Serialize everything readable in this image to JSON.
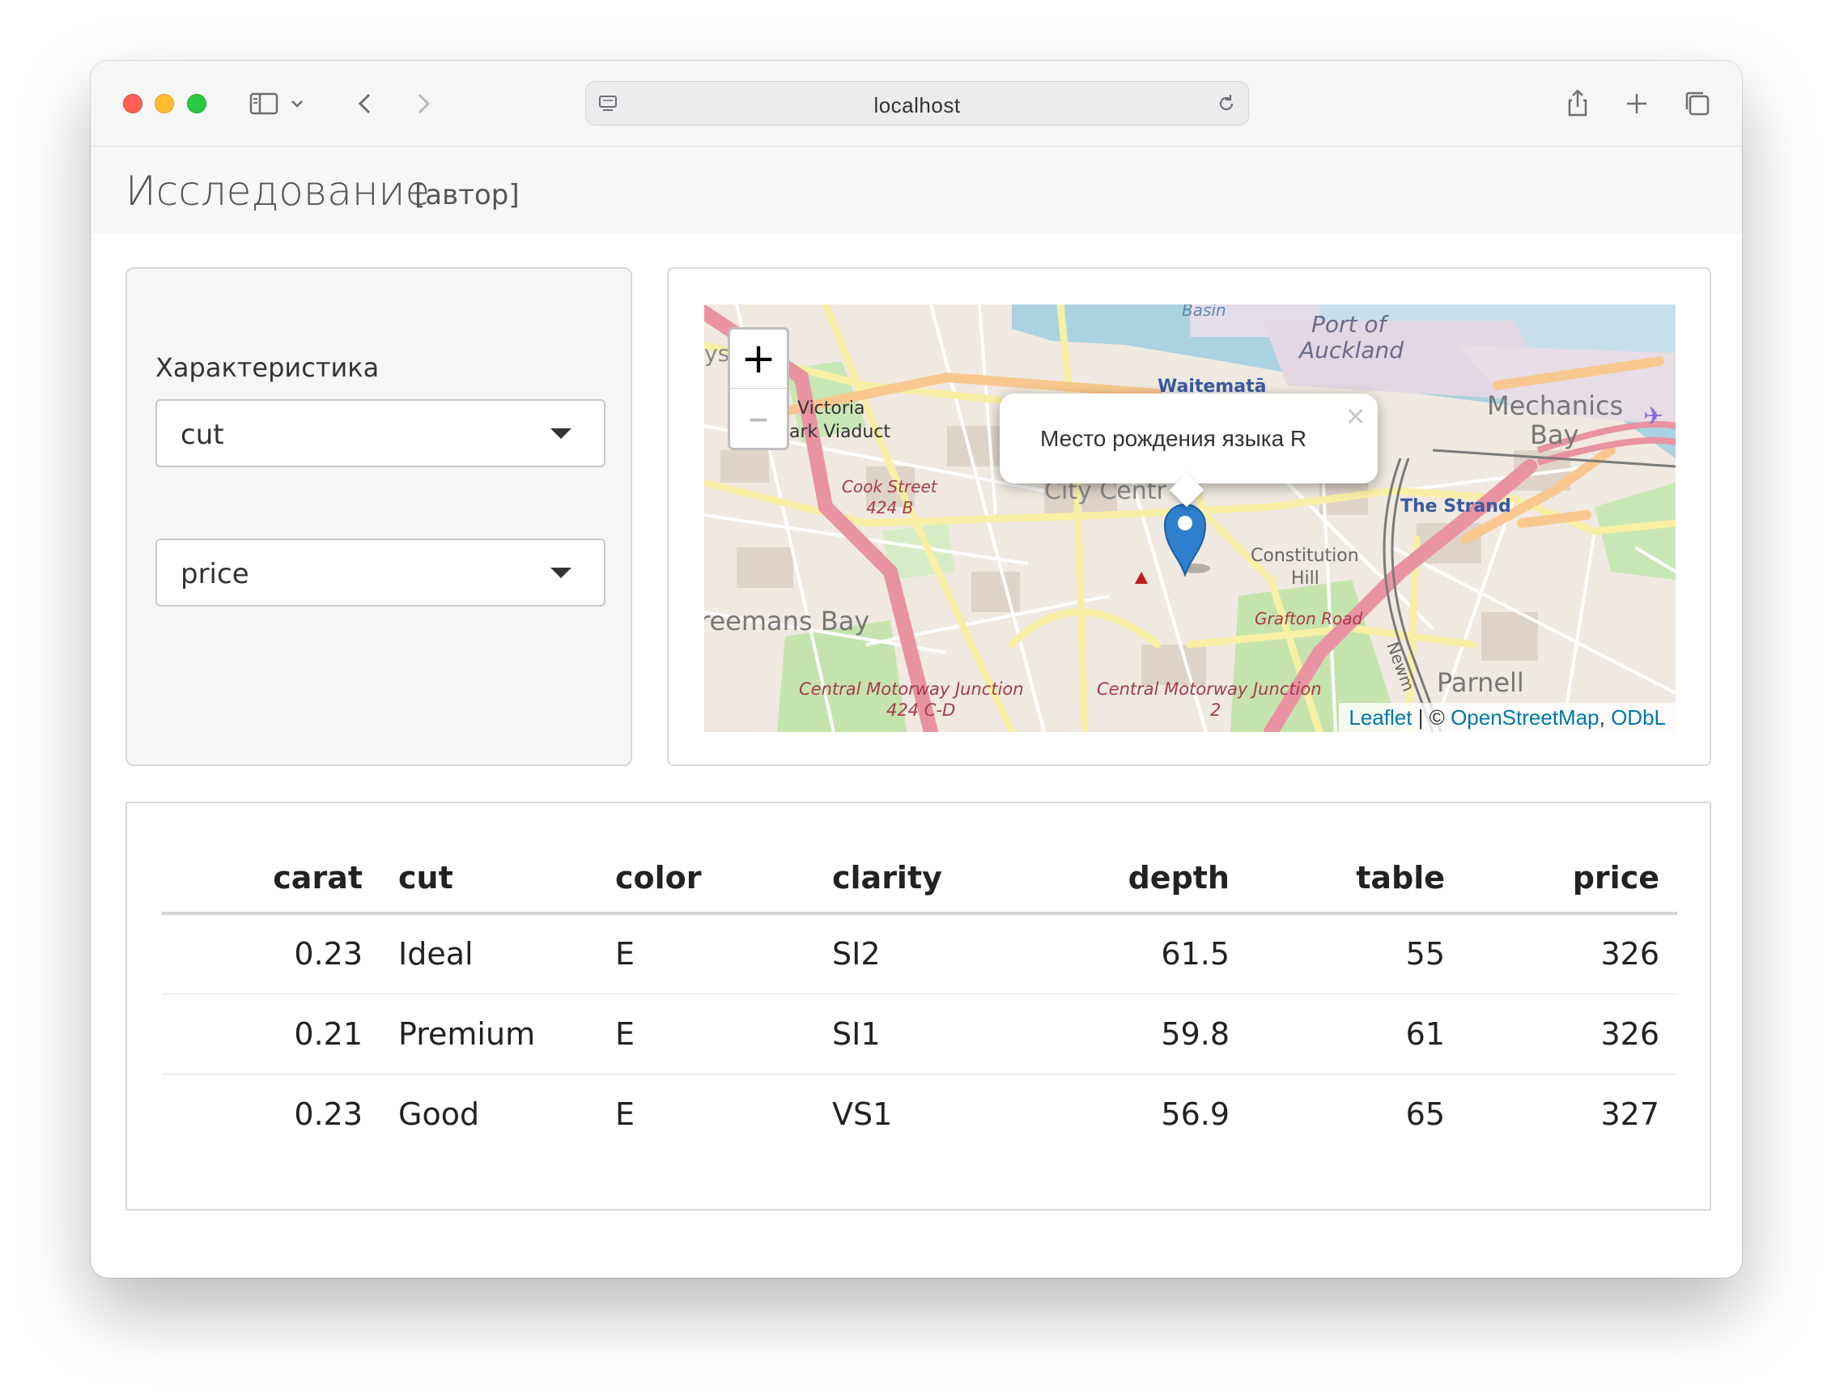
{
  "browser": {
    "url": "localhost"
  },
  "app": {
    "title": "Исследование",
    "subtitle": "[автор]"
  },
  "sidebar": {
    "label": "Характеристика",
    "select1_value": "cut",
    "select2_value": "price"
  },
  "map": {
    "zoom_in": "+",
    "zoom_out": "–",
    "popup_text": "Место рождения языка R",
    "popup_close": "×",
    "attribution": {
      "leaflet": "Leaflet",
      "sep": " | © ",
      "osm": "OpenStreetMap",
      "comma": ", ",
      "odbl": "ODbL"
    },
    "places": {
      "basin": "Basin",
      "port1": "Port of",
      "port2": "Auckland",
      "waitemata": "Waitematā",
      "mech1": "Mechanics",
      "mech2": "Bay",
      "vic1": "Victoria",
      "vic2": "ark Viaduct",
      "cook1": "Cook Street",
      "cook2": "424 B",
      "citycentre": "City Centr",
      "strand": "The Strand",
      "const1": "Constitution",
      "const2": "Hill",
      "grafton": "Grafton Road",
      "freemans": "reemans Bay",
      "parnell": "Parnell",
      "cmj1a": "Central Motorway Junction",
      "cmj1b": "424 C-D",
      "cmj2a": "Central Motorway Junction",
      "cmj2b": "2",
      "newmarket": "Newm",
      "ys": "ys"
    }
  },
  "table": {
    "headers": [
      "carat",
      "cut",
      "color",
      "clarity",
      "depth",
      "table",
      "price"
    ],
    "rows": [
      [
        "0.23",
        "Ideal",
        "E",
        "SI2",
        "61.5",
        "55",
        "326"
      ],
      [
        "0.21",
        "Premium",
        "E",
        "SI1",
        "59.8",
        "61",
        "326"
      ],
      [
        "0.23",
        "Good",
        "E",
        "VS1",
        "56.9",
        "65",
        "327"
      ]
    ]
  }
}
